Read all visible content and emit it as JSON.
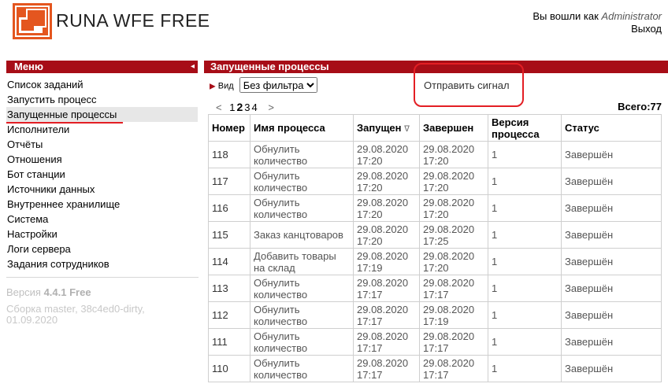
{
  "header": {
    "app_name": "RUNA WFE FREE",
    "logged_in_label": "Вы вошли как",
    "username": "Administrator",
    "logout": "Выход"
  },
  "menu": {
    "title": "Меню",
    "collapse_icon": "◂",
    "items": [
      "Список заданий",
      "Запустить процесс",
      "Запущенные процессы",
      "Исполнители",
      "Отчёты",
      "Отношения",
      "Бот станции",
      "Источники данных",
      "Внутреннее хранилище",
      "Система",
      "Настройки",
      "Логи сервера",
      "Задания сотрудников"
    ],
    "active_index": 2,
    "version_label": "Версия",
    "version": "4.4.1 Free",
    "build": "Сборка master, 38c4ed0-dirty, 01.09.2020"
  },
  "main": {
    "title": "Запущенные процессы",
    "view_label": "Вид",
    "filter_selected": "Без фильтра",
    "signal_button": "Отправить сигнал",
    "pager": {
      "prev": "<",
      "pages": [
        "1",
        "2",
        "3",
        "4"
      ],
      "current": "2",
      "next": ">"
    },
    "total": "Всего:77",
    "columns": [
      "Номер",
      "Имя процесса",
      "Запущен",
      "Завершен",
      "Версия процесса",
      "Статус"
    ],
    "sort_icon": "ᐁ",
    "rows": [
      {
        "id": "118",
        "name": "Обнулить количество",
        "started": "29.08.2020 17:20",
        "ended": "29.08.2020 17:20",
        "version": "1",
        "status": "Завершён"
      },
      {
        "id": "117",
        "name": "Обнулить количество",
        "started": "29.08.2020 17:20",
        "ended": "29.08.2020 17:20",
        "version": "1",
        "status": "Завершён"
      },
      {
        "id": "116",
        "name": "Обнулить количество",
        "started": "29.08.2020 17:20",
        "ended": "29.08.2020 17:20",
        "version": "1",
        "status": "Завершён"
      },
      {
        "id": "115",
        "name": "Заказ канцтоваров",
        "started": "29.08.2020 17:20",
        "ended": "29.08.2020 17:25",
        "version": "1",
        "status": "Завершён"
      },
      {
        "id": "114",
        "name": "Добавить товары на склад",
        "started": "29.08.2020 17:19",
        "ended": "29.08.2020 17:20",
        "version": "1",
        "status": "Завершён"
      },
      {
        "id": "113",
        "name": "Обнулить количество",
        "started": "29.08.2020 17:17",
        "ended": "29.08.2020 17:17",
        "version": "1",
        "status": "Завершён"
      },
      {
        "id": "112",
        "name": "Обнулить количество",
        "started": "29.08.2020 17:17",
        "ended": "29.08.2020 17:19",
        "version": "1",
        "status": "Завершён"
      },
      {
        "id": "111",
        "name": "Обнулить количество",
        "started": "29.08.2020 17:17",
        "ended": "29.08.2020 17:17",
        "version": "1",
        "status": "Завершён"
      },
      {
        "id": "110",
        "name": "Обнулить количество",
        "started": "29.08.2020 17:17",
        "ended": "29.08.2020 17:17",
        "version": "1",
        "status": "Завершён"
      }
    ]
  },
  "colors": {
    "brand": "#a70d17",
    "annotation": "#e31e24"
  }
}
